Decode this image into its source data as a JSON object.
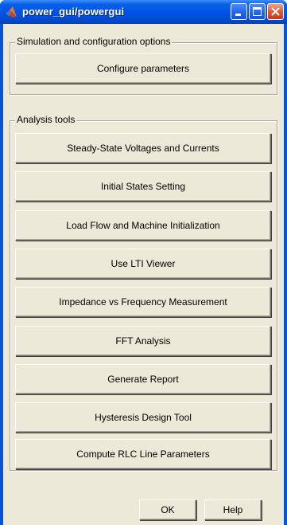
{
  "window": {
    "title": "power_gui/powergui",
    "app_icon": "matlab-logo-icon",
    "controls": [
      "minimize-icon",
      "maximize-icon",
      "close-icon"
    ],
    "colors": {
      "titlebar": "#0055e5",
      "frame": "#0a53d6",
      "client": "#ece9d8",
      "close_button": "#e2542e"
    }
  },
  "simulation_group": {
    "title": "Simulation and configuration options",
    "buttons": [
      "Configure parameters"
    ]
  },
  "analysis_group": {
    "title": "Analysis tools",
    "buttons": [
      "Steady-State Voltages and Currents",
      "Initial States Setting",
      "Load Flow and Machine Initialization",
      "Use LTI Viewer",
      "Impedance vs Frequency Measurement",
      "FFT Analysis",
      "Generate Report",
      "Hysteresis Design Tool",
      "Compute RLC  Line Parameters"
    ]
  },
  "footer": {
    "ok_label": "OK",
    "help_label": "Help"
  }
}
